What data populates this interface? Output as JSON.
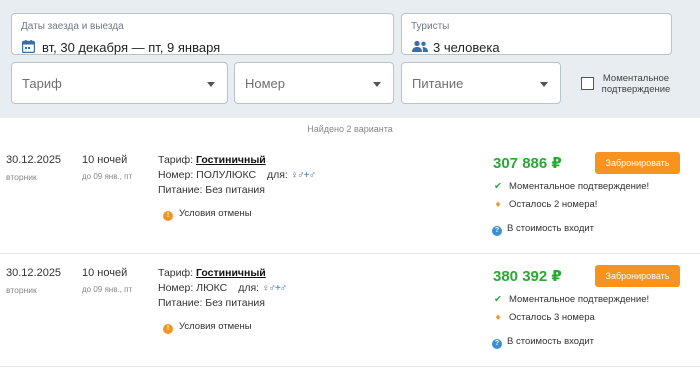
{
  "filters": {
    "dates": {
      "legend": "Даты заезда и выезда",
      "value": "вт, 30 декабря — пт, 9 января",
      "icon": "calendar-icon"
    },
    "tourists": {
      "legend": "Туристы",
      "value": "3 человека",
      "icon": "people-icon"
    },
    "tariff_placeholder": "Тариф",
    "room_placeholder": "Номер",
    "meal_placeholder": "Питание",
    "instant_label_1": "Моментальное",
    "instant_label_2": "подтверждение"
  },
  "found_text": "Найдено 2 варианта",
  "colors": {
    "accent_orange": "#f7931e",
    "price_green": "#2aa836",
    "filter_bg": "#e8edf2"
  },
  "offers": [
    {
      "date": "30.12.2025",
      "weekday": "вторник",
      "nights": "10 ночей",
      "until": "до 09 янв., пт",
      "tariff_label": "Тариф:",
      "tariff": "Гостиничный",
      "room_label": "Номер:",
      "room": "ПОЛУЛЮКС",
      "for_label": "для:",
      "meal_label": "Питание:",
      "meal": "Без питания",
      "cancel": "Условия отмены",
      "price": "307 886 ₽",
      "book": "Забронировать",
      "instant": "Моментальное подтверждение!",
      "remaining": "Осталось 2 номера!",
      "included": "В стоимость входит"
    },
    {
      "date": "30.12.2025",
      "weekday": "вторник",
      "nights": "10 ночей",
      "until": "до 09 янв., пт",
      "tariff_label": "Тариф:",
      "tariff": "Гостиничный",
      "room_label": "Номер:",
      "room": "ЛЮКС",
      "for_label": "для:",
      "meal_label": "Питание:",
      "meal": "Без питания",
      "cancel": "Условия отмены",
      "price": "380 392 ₽",
      "book": "Забронировать",
      "instant": "Моментальное подтверждение!",
      "remaining": "Осталось 3 номера",
      "included": "В стоимость входит"
    }
  ]
}
